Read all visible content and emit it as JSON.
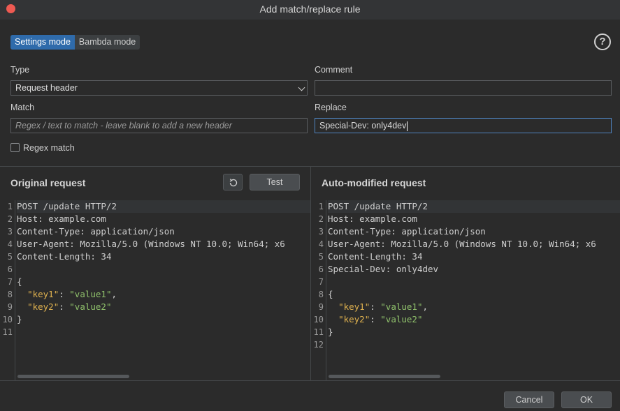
{
  "window": {
    "title": "Add match/replace rule"
  },
  "mode": {
    "settings_label": "Settings mode",
    "bambda_label": "Bambda mode",
    "active": "settings"
  },
  "help": {
    "glyph": "?"
  },
  "type": {
    "label": "Type",
    "value": "Request header"
  },
  "comment": {
    "label": "Comment",
    "value": ""
  },
  "match": {
    "label": "Match",
    "placeholder": "Regex / text to match - leave blank to add a new header",
    "value": ""
  },
  "replace": {
    "label": "Replace",
    "value": "Special-Dev: only4dev"
  },
  "regex": {
    "label": "Regex match",
    "checked": false
  },
  "original": {
    "title": "Original request",
    "test_label": "Test",
    "reset_icon": "reset-icon",
    "line_numbers": [
      "1",
      "2",
      "3",
      "4",
      "5",
      "6",
      "7",
      "8",
      "9",
      "10",
      "11"
    ]
  },
  "modified": {
    "title": "Auto-modified request",
    "line_numbers": [
      "1",
      "2",
      "3",
      "4",
      "5",
      "6",
      "7",
      "8",
      "9",
      "10",
      "11",
      "12"
    ]
  },
  "code": {
    "request_line": "POST /update HTTP/2",
    "host_name": "Host",
    "host_value": "example.com",
    "ctype_name": "Content-Type",
    "ctype_value": "application/json",
    "ua_name": "User-Agent",
    "ua_value": "Mozilla/5.0 (Windows NT 10.0; Win64; x6",
    "clen_name": "Content-Length",
    "clen_value": "34",
    "special_name": "Special-Dev",
    "special_value": "only4dev",
    "open_brace": "{",
    "close_brace": "}",
    "key1": "\"key1\"",
    "value1": "\"value1\"",
    "key2": "\"key2\"",
    "value2": "\"value2\""
  },
  "footer": {
    "cancel_label": "Cancel",
    "ok_label": "OK"
  },
  "colors": {
    "accent": "#2f6bab",
    "close": "#ee5a52",
    "json_key": "#e0b24f",
    "json_string": "#8fc06b"
  }
}
